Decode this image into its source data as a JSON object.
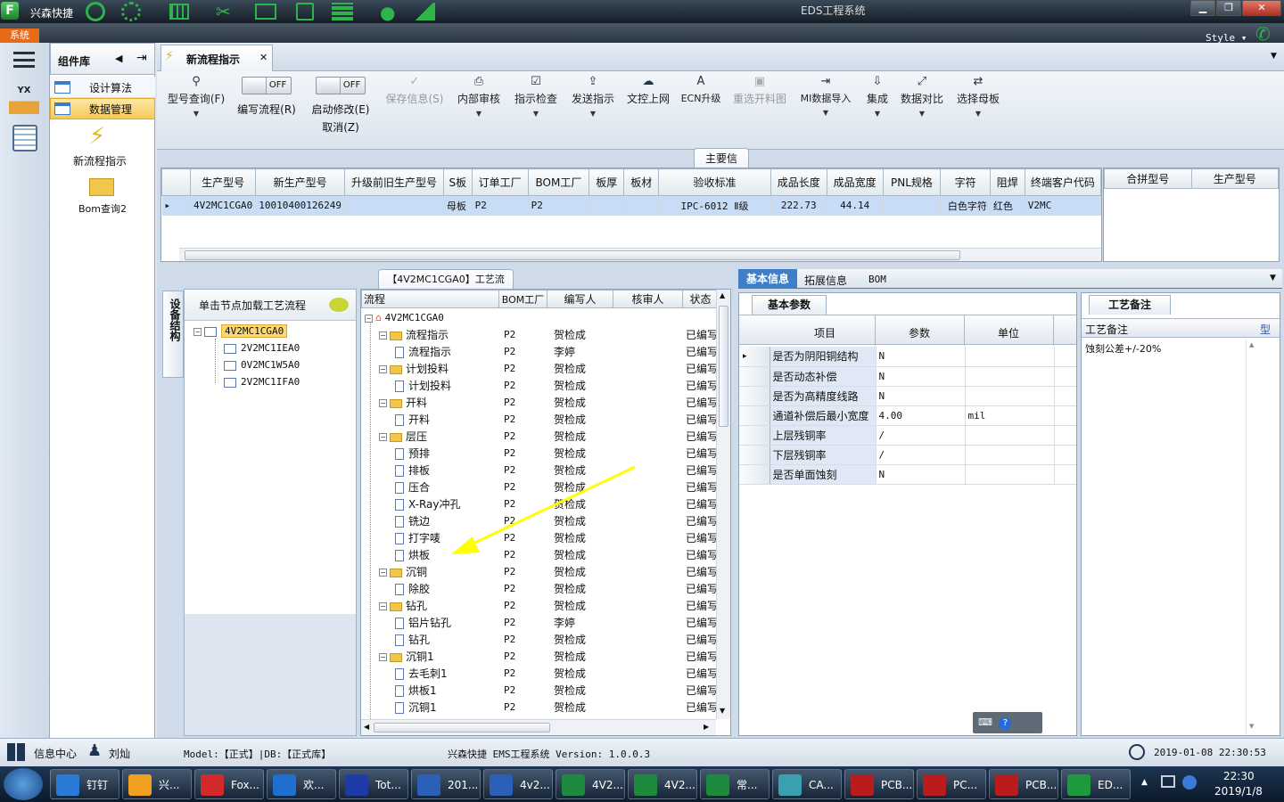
{
  "app": {
    "brand": "兴森快捷",
    "window_title": "EDS工程系统",
    "system_menu": "系统",
    "style_label": "Style"
  },
  "component_panel": {
    "title": "组件库",
    "items": [
      {
        "label": "设计算法"
      },
      {
        "label": "数据管理"
      }
    ],
    "launchers": [
      {
        "label": "新流程指示"
      },
      {
        "label": "Bom查询2"
      }
    ]
  },
  "doc_tab": {
    "label": "新流程指示"
  },
  "toolbar": {
    "model_query": "型号查询(F)",
    "toggle_off": "OFF",
    "edit_flow": "编写流程(R)",
    "start_modify": "启动修改(E)",
    "cancel": "取消(Z)",
    "save_info": "保存信息(S)",
    "internal_review": "内部审核",
    "instr_check": "指示检查",
    "send_instr": "发送指示",
    "doc_upload": "文控上网",
    "ecn_upgrade": "ECN升级",
    "reselect_cut": "重选开料图",
    "mi_import": "MI数据导入",
    "integrate": "集成",
    "data_compare": "数据对比",
    "select_mother": "选择母板"
  },
  "main_info": {
    "title": "主要信息",
    "columns": [
      "生产型号",
      "新生产型号",
      "升级前旧生产型号",
      "S板",
      "订单工厂",
      "BOM工厂",
      "板厚",
      "板材",
      "验收标准",
      "成品长度",
      "成品宽度",
      "PNL规格",
      "字符",
      "阻焊",
      "终端客户代码"
    ],
    "row": [
      "4V2MC1CGA0",
      "10010400126249",
      "",
      "母板",
      "P2",
      "P2",
      "",
      "",
      "IPC-6012 Ⅱ级",
      "222.73",
      "44.14",
      "",
      "白色字符",
      "红色",
      "V2MC"
    ],
    "side_columns": [
      "合拼型号",
      "生产型号"
    ]
  },
  "structure": {
    "side_tab": "设备结构",
    "header": "单击节点加载工艺流程",
    "nodes": [
      {
        "label": "4V2MC1CGA0"
      },
      {
        "label": "2V2MC1IEA0"
      },
      {
        "label": "0V2MC1W5A0"
      },
      {
        "label": "2V2MC1IFA0"
      }
    ]
  },
  "flow": {
    "title": "【4V2MC1CGA0】工艺流程",
    "columns": [
      "流程",
      "BOM工厂",
      "编写人",
      "核审人",
      "状态"
    ],
    "root": "4V2MC1CGA0",
    "rows": [
      {
        "name": "流程指示",
        "group": true,
        "factory": "P2",
        "author": "贺检成",
        "status": "已编写"
      },
      {
        "name": "流程指示",
        "group": false,
        "factory": "P2",
        "author": "李婷",
        "status": "已编写"
      },
      {
        "name": "计划投料",
        "group": true,
        "factory": "P2",
        "author": "贺检成",
        "status": "已编写"
      },
      {
        "name": "计划投料",
        "group": false,
        "factory": "P2",
        "author": "贺检成",
        "status": "已编写"
      },
      {
        "name": "开料",
        "group": true,
        "factory": "P2",
        "author": "贺检成",
        "status": "已编写"
      },
      {
        "name": "开料",
        "group": false,
        "factory": "P2",
        "author": "贺检成",
        "status": "已编写"
      },
      {
        "name": "层压",
        "group": true,
        "factory": "P2",
        "author": "贺检成",
        "status": "已编写"
      },
      {
        "name": "预排",
        "group": false,
        "factory": "P2",
        "author": "贺检成",
        "status": "已编写"
      },
      {
        "name": "排板",
        "group": false,
        "factory": "P2",
        "author": "贺检成",
        "status": "已编写"
      },
      {
        "name": "压合",
        "group": false,
        "factory": "P2",
        "author": "贺检成",
        "status": "已编写"
      },
      {
        "name": "X-Ray冲孔",
        "group": false,
        "factory": "P2",
        "author": "贺检成",
        "status": "已编写"
      },
      {
        "name": "铣边",
        "group": false,
        "factory": "P2",
        "author": "贺检成",
        "status": "已编写"
      },
      {
        "name": "打字唛",
        "group": false,
        "factory": "P2",
        "author": "贺检成",
        "status": "已编写"
      },
      {
        "name": "烘板",
        "group": false,
        "factory": "P2",
        "author": "贺检成",
        "status": "已编写"
      },
      {
        "name": "沉铜",
        "group": true,
        "factory": "P2",
        "author": "贺检成",
        "status": "已编写"
      },
      {
        "name": "除胶",
        "group": false,
        "factory": "P2",
        "author": "贺检成",
        "status": "已编写"
      },
      {
        "name": "钻孔",
        "group": true,
        "factory": "P2",
        "author": "贺检成",
        "status": "已编写"
      },
      {
        "name": "铝片钻孔",
        "group": false,
        "factory": "P2",
        "author": "李婷",
        "status": "已编写"
      },
      {
        "name": "钻孔",
        "group": false,
        "factory": "P2",
        "author": "贺检成",
        "status": "已编写"
      },
      {
        "name": "沉铜1",
        "group": true,
        "factory": "P2",
        "author": "贺检成",
        "status": "已编写"
      },
      {
        "name": "去毛刺1",
        "group": false,
        "factory": "P2",
        "author": "贺检成",
        "status": "已编写"
      },
      {
        "name": "烘板1",
        "group": false,
        "factory": "P2",
        "author": "贺检成",
        "status": "已编写"
      },
      {
        "name": "沉铜1",
        "group": false,
        "factory": "P2",
        "author": "贺检成",
        "status": "已编写"
      }
    ]
  },
  "info_tabs": {
    "basic": "基本信息",
    "extended": "拓展信息",
    "bom": "BOM"
  },
  "basic_params": {
    "title": "基本参数",
    "columns": [
      "项目",
      "参数",
      "单位"
    ],
    "rows": [
      {
        "item": "是否为阴阳铜结构",
        "value": "N",
        "unit": ""
      },
      {
        "item": "是否动态补偿",
        "value": "N",
        "unit": ""
      },
      {
        "item": "是否为高精度线路",
        "value": "N",
        "unit": ""
      },
      {
        "item": "通道补偿后最小宽度",
        "value": "4.00",
        "unit": "mil"
      },
      {
        "item": "上层残铜率",
        "value": "/",
        "unit": ""
      },
      {
        "item": "下层残铜率",
        "value": "/",
        "unit": ""
      },
      {
        "item": "是否单面蚀刻",
        "value": "N",
        "unit": ""
      }
    ]
  },
  "process_notes": {
    "tab": "工艺备注",
    "column": "工艺备注",
    "column2": "型",
    "note": "蚀刻公差+/-20%"
  },
  "statusbar": {
    "info_center": "信息中心",
    "user": "刘灿",
    "model": "Model:【正式】|DB:【正式库】",
    "version": "兴森快捷 EMS工程系统 Version: 1.0.0.3",
    "datetime": "2019-01-08 22:30:53"
  },
  "taskbar": {
    "items": [
      "钉钉",
      "兴...",
      "Fox...",
      "欢...",
      "Tot...",
      "201...",
      "4v2...",
      "4V2...",
      "4V2...",
      "常...",
      "CA...",
      "PCB...",
      "PC...",
      "PCB...",
      "ED..."
    ],
    "time": "22:30",
    "date": "2019/1/8"
  },
  "colors": {
    "accent": "#3f7fc8",
    "selected_row": "#c8dcf5",
    "annotation_arrow": "#ffff00",
    "tree_folder": "#f2c64a"
  }
}
